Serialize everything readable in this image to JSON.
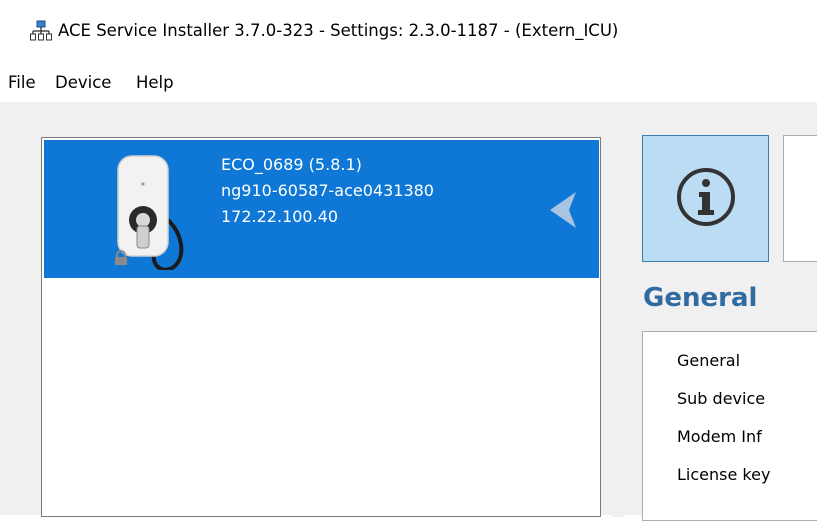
{
  "window": {
    "title": "ACE Service Installer 3.7.0-323 - Settings: 2.3.0-1187 -  (Extern_ICU)",
    "app_icon": "network-tree-icon"
  },
  "menu": {
    "items": [
      "File",
      "Device",
      "Help"
    ]
  },
  "device_list": {
    "selected": {
      "name_version": "ECO_0689 (5.8.1)",
      "serial": "ng910-60587-ace0431380",
      "ip": "172.22.100.40",
      "icons": [
        "wallbox-charger-icon",
        "lock-icon",
        "collapse-arrow-icon"
      ]
    }
  },
  "right_panel": {
    "tiles": [
      {
        "icon": "info-icon",
        "selected": true
      },
      {
        "icon": "blank-tile",
        "selected": false
      }
    ],
    "heading": "General",
    "nav_items": [
      "General",
      "Sub device",
      "Modem Inf",
      "License key"
    ]
  },
  "colors": {
    "selection": "#0f78d7",
    "tile_selected": "#bcdcf4",
    "heading": "#2f6aa1",
    "background": "#f0f0f0"
  }
}
